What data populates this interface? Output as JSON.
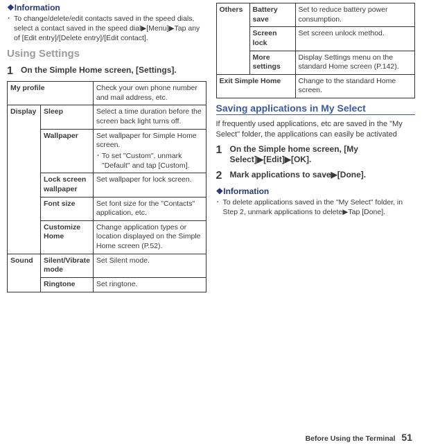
{
  "col1": {
    "info_heading": "❖Information",
    "info_bullet": "To change/delete/edit contacts saved in the speed dials, select a contact saved in the speed dial▶[Menu]▶Tap any of [Edit entry]/[Delete entry]/[Edit contact].",
    "using_settings": "Using Settings",
    "step1_num": "1",
    "step1_text": "On the Simple Home screen, [Settings].",
    "table": {
      "my_profile": {
        "label": "My profile",
        "desc": "Check your own phone number and mail address, etc."
      },
      "display": {
        "label": "Display",
        "sleep": {
          "label": "Sleep",
          "desc": "Select a time duration before the screen back light turns off."
        },
        "wallpaper": {
          "label": "Wallpaper",
          "desc": "Set wallpaper for Simple Home screen.",
          "sub": "To set \"Custom\", unmark \"Default\" and tap [Custom]."
        },
        "lock": {
          "label": "Lock screen wallpaper",
          "desc": "Set wallpaper for lock screen."
        },
        "font": {
          "label": "Font size",
          "desc": "Set font size for the \"Contacts\" application, etc."
        },
        "custom": {
          "label": "Customize Home",
          "desc": "Change application types or location displayed on the Simple Home screen (P.52)."
        }
      },
      "sound": {
        "label": "Sound",
        "silent": {
          "label": "Silent/Vibrate mode",
          "desc": "Set Silent mode."
        },
        "ringtone": {
          "label": "Ringtone",
          "desc": "Set ringtone."
        }
      }
    }
  },
  "col2": {
    "table": {
      "others": {
        "label": "Others",
        "battery": {
          "label": "Battery save",
          "desc": "Set to reduce battery power consumption."
        },
        "screenlock": {
          "label": "Screen lock",
          "desc": "Set screen unlock method."
        },
        "more": {
          "label": "More settings",
          "desc": "Display Settings menu on the standard Home screen (P.142)."
        }
      },
      "exit": {
        "label": "Exit Simple Home",
        "desc": "Change to the standard Home screen."
      }
    },
    "h2": "Saving applications in My Select",
    "para": "If frequently used applications, etc are saved in the \"My Select\" folder, the applications can easily be activated",
    "step1_num": "1",
    "step1_text": "On the Simple home screen, [My Select]▶[Edit]▶[OK].",
    "step2_num": "2",
    "step2_text": "Mark applications to save▶[Done].",
    "info_heading": "❖Information",
    "info_bullet": "To delete applications saved in the \"My Select\" folder, in Step 2, unmark applications to delete▶Tap [Done]."
  },
  "footer": {
    "section": "Before Using the Terminal",
    "page": "51"
  }
}
